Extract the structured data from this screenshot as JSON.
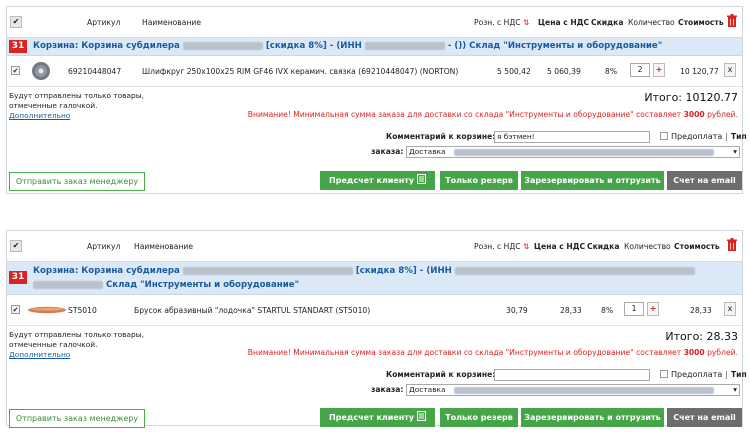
{
  "colors": {
    "accent_blue": "#1b5aa0",
    "title_bg": "#dbe9f6",
    "red": "#d9241f",
    "green": "#45a548",
    "grey": "#6d6d6d"
  },
  "columns": {
    "article": "Артикул",
    "name": "Наименование",
    "retail": "Розн. с НДС",
    "price": "Цена с НДС",
    "discount": "Скидка",
    "qty": "Количество",
    "cost": "Стоимость"
  },
  "carts": [
    {
      "number": "31",
      "title_prefix": "Корзина: Корзина субдилера",
      "title_mid": "[скидка 8%] - (ИНН",
      "title_suffix": "- ()) Склад \"Инструменты и оборудование\"",
      "item": {
        "article": "69210448047",
        "name": "Шлифкруг 250x100x25 RIM GF46 IVX керамич. связка (69210448047) (NORTON)",
        "retail": "5 500,42",
        "price": "5 060,39",
        "discount": "8%",
        "qty": "2",
        "cost": "10 120,77"
      },
      "total": "Итого: 10120.77",
      "comment_value": "я бэтмен!"
    },
    {
      "number": "31",
      "title_prefix": "Корзина: Корзина субдилера",
      "title_mid": "[скидка 8%] - (ИНН",
      "title_suffix": "Склад \"Инструменты и оборудование\"",
      "item": {
        "article": "ST5010",
        "name": "Брусок абразивный \"лодочка\" STARTUL STANDART (ST5010)",
        "retail": "30,79",
        "price": "28,33",
        "discount": "8%",
        "qty": "1",
        "cost": "28,33"
      },
      "total": "Итого: 28.33",
      "comment_value": ""
    }
  ],
  "common": {
    "note_line1": "Будут отправлены только товары,",
    "note_line2": "отмеченные галочкой.",
    "more": "Дополнительно",
    "warn_prefix": "Внимание! Минимальная сумма заказа для доставки со склада \"Инструменты и оборудование\" составляет ",
    "warn_amount": "3000",
    "warn_suffix": " рублей.",
    "comment_label": "Комментарий к корзине:",
    "prepay": "Предоплата",
    "type": "Тип",
    "order_label": "заказа:",
    "order_value": "Доставка",
    "btn_send": "Отправить заказ менеджеру",
    "btn_invoice": "Предсчет клиенту",
    "btn_reserve": "Только резерв",
    "btn_ship": "Зарезервировать и отгрузить",
    "btn_email": "Счет на email",
    "check": "✔",
    "sort": "⇅",
    "plus": "+",
    "close": "x",
    "dropdown": "▾"
  }
}
